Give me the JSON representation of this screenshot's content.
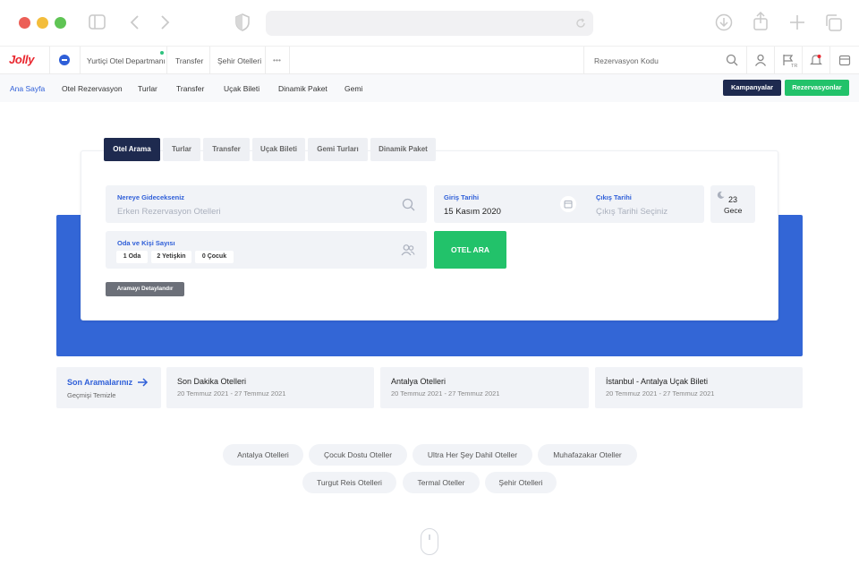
{
  "topnav": {
    "logo": "Jolly",
    "items": [
      "Yurtiçi Otel Departmanı",
      "Transfer",
      "Şehir Otelleri",
      "•••"
    ],
    "reservation_code": "Rezervasyon Kodu",
    "lang": "TR"
  },
  "subnav": {
    "items": [
      "Ana Sayfa",
      "Otel Rezervasyon",
      "Turlar",
      "Transfer",
      "Uçak Bileti",
      "Dinamik Paket",
      "Gemi"
    ],
    "campaigns": "Kampanyalar",
    "reservations": "Rezervasyonlar"
  },
  "tabs": [
    "Otel Arama",
    "Turlar",
    "Transfer",
    "Uçak Bileti",
    "Gemi Turları",
    "Dinamik Paket"
  ],
  "search": {
    "dest_label": "Nereye Gidecekseniz",
    "dest_placeholder": "Erken Rezervasyon Otelleri",
    "checkin_label": "Giriş Tarihi",
    "checkin_value": "15 Kasım 2020",
    "checkout_label": "Çıkış Tarihi",
    "checkout_placeholder": "Çıkış Tarihi Seçiniz",
    "nights_value": "23",
    "nights_label": "Gece",
    "rooms_label": "Oda ve Kişi Sayısı",
    "rooms": "1 Oda",
    "adults": "2 Yetişkin",
    "children": "0 Çocuk",
    "search_button": "OTEL ARA",
    "detail_button": "Aramayı Detaylandır"
  },
  "recent": {
    "title": "Son Aramalarınız",
    "clear": "Geçmişi Temizle",
    "items": [
      {
        "title": "Son Dakika Otelleri",
        "dates": "20 Temmuz 2021 - 27 Temmuz 2021"
      },
      {
        "title": "Antalya Otelleri",
        "dates": "20 Temmuz 2021 - 27 Temmuz 2021"
      },
      {
        "title": "İstanbul - Antalya Uçak Bileti",
        "dates": "20 Temmuz 2021 - 27 Temmuz 2021"
      }
    ]
  },
  "pills": [
    "Antalya Otelleri",
    "Çocuk Dostu Oteller",
    "Ultra Her Şey Dahil Oteller",
    "Muhafazakar Oteller",
    "Turgut Reis Otelleri",
    "Termal Oteller",
    "Şehir Otelleri"
  ],
  "colors": {
    "brand": "#e9262e",
    "primary": "#2f5fd8",
    "dark": "#1e2a4f",
    "green": "#22c26a",
    "band": "#3366d6"
  }
}
